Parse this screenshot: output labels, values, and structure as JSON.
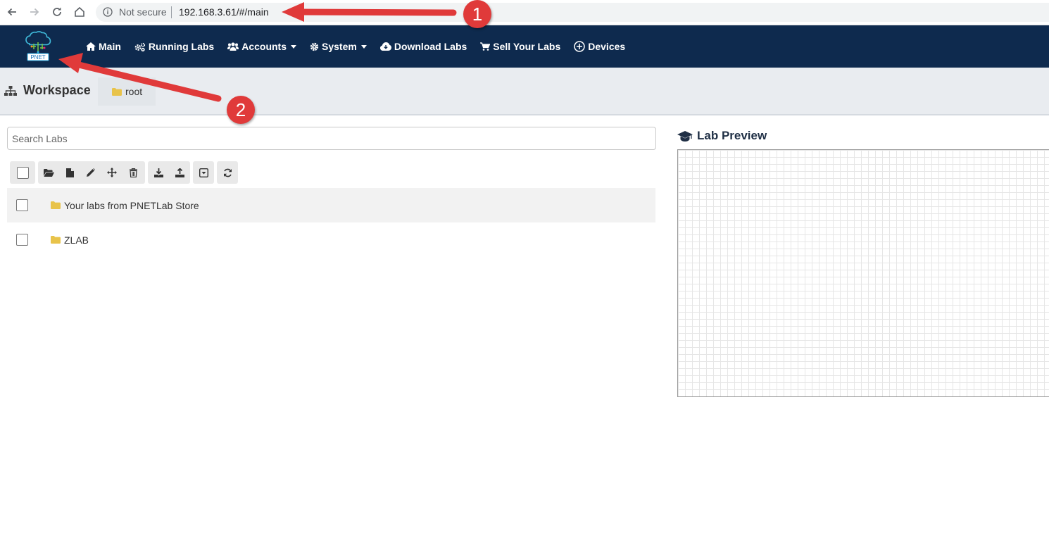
{
  "browser": {
    "security_label": "Not secure",
    "url": "192.168.3.61/#/main",
    "icons": [
      "back-arrow-icon",
      "forward-arrow-icon",
      "reload-icon",
      "home-icon",
      "info-icon"
    ]
  },
  "navbar": {
    "logo_text": "PNET",
    "items": [
      {
        "label": "Main",
        "icon": "home-icon"
      },
      {
        "label": "Running Labs",
        "icon": "gears-icon"
      },
      {
        "label": "Accounts",
        "icon": "users-icon",
        "dropdown": true
      },
      {
        "label": "System",
        "icon": "gear-icon",
        "dropdown": true
      },
      {
        "label": "Download Labs",
        "icon": "cloud-download-icon"
      },
      {
        "label": "Sell Your Labs",
        "icon": "cart-icon"
      },
      {
        "label": "Devices",
        "icon": "plus-circle-icon"
      }
    ],
    "colors": {
      "background": "#0e2a4e",
      "text": "#ffffff"
    }
  },
  "workspace": {
    "title": "Workspace",
    "breadcrumb": "root"
  },
  "search": {
    "placeholder": "Search Labs"
  },
  "toolbar": {
    "icons": [
      "folder-open-icon",
      "new-file-icon",
      "edit-pencil-icon",
      "move-arrows-icon",
      "trash-icon",
      "import-icon",
      "export-icon",
      "collapse-icon",
      "refresh-icon"
    ]
  },
  "labs": [
    {
      "name": "Your labs from PNETLab Store",
      "type": "folder"
    },
    {
      "name": "ZLAB",
      "type": "folder"
    }
  ],
  "preview": {
    "title": "Lab Preview"
  },
  "annotations": {
    "badge_1": "1",
    "badge_2": "2",
    "color": "#e03a3a"
  }
}
